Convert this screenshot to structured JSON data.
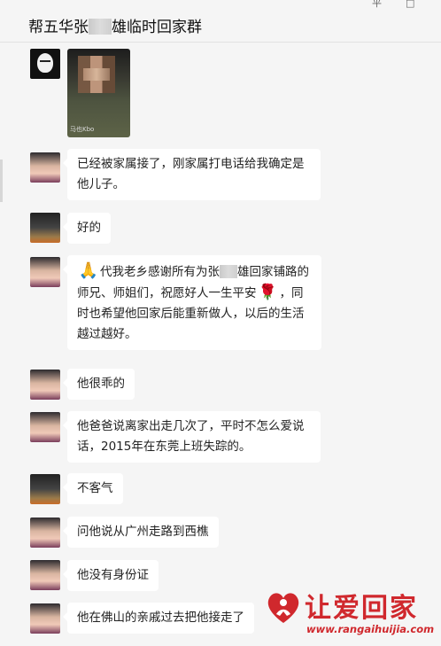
{
  "header": {
    "title_part1": "帮五华张",
    "title_part2": "雄临时回家群",
    "win_restore": "平",
    "win_close": "□"
  },
  "messages": [
    {
      "name": "msg-1-photo",
      "avatar": "mask-icon",
      "type": "image",
      "photo_watermark": "马也Kbo"
    },
    {
      "name": "msg-2",
      "avatar": "female-avatar",
      "lines": [
        "已经被家属接了，刚家属打电话给我确定是",
        "他儿子。"
      ]
    },
    {
      "name": "msg-3",
      "avatar": "dark-avatar",
      "text": "好的"
    },
    {
      "name": "msg-4",
      "avatar": "female-avatar",
      "prefix": "代我老乡感谢所有为张",
      "suffix": "雄回家铺路的",
      "line2a": "师兄、师姐们，祝愿好人一生平安",
      "line2b": "，同",
      "line3": "时也希望他回家后能重新做人，以后的生活",
      "line4": "越过越好。"
    },
    {
      "name": "msg-5",
      "avatar": "female-avatar",
      "text": "他很乖的"
    },
    {
      "name": "msg-6",
      "avatar": "female-avatar",
      "lines": [
        "他爸爸说离家出走几次了，平时不怎么爱说",
        "话，2015年在东莞上班失踪的。"
      ]
    },
    {
      "name": "msg-7",
      "avatar": "dark-avatar",
      "text": "不客气"
    },
    {
      "name": "msg-8",
      "avatar": "female-avatar",
      "text": "问他说从广州走路到西樵"
    },
    {
      "name": "msg-9",
      "avatar": "female-avatar",
      "text": "他没有身份证"
    },
    {
      "name": "msg-10",
      "avatar": "female-avatar",
      "text": "他在佛山的亲戚过去把他接走了"
    }
  ],
  "logo": {
    "text": "让爱回家",
    "url": "www.rangaihuijia.com"
  },
  "colors": {
    "background": "#f5f5f5",
    "bubble": "#ffffff",
    "logo_red": "#d0282d"
  }
}
